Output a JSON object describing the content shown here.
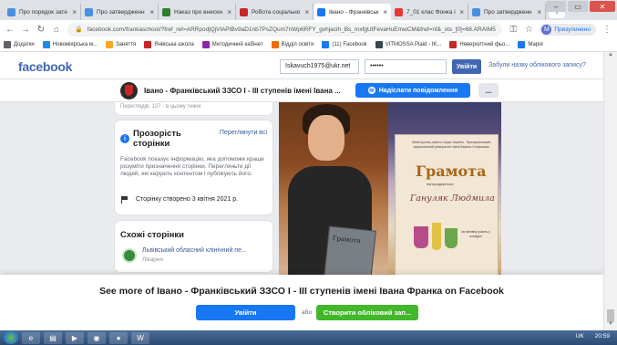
{
  "browser": {
    "tabs": [
      {
        "title": "Про порядок зате",
        "color": "#4a90e2",
        "active": false
      },
      {
        "title": "Про затвердженн",
        "color": "#4a90e2",
        "active": false
      },
      {
        "title": "Наказ про внесен",
        "color": "#2e7d32",
        "active": false
      },
      {
        "title": "Робота соціально",
        "color": "#c62828",
        "active": false
      },
      {
        "title": "Івано - Франківськ",
        "color": "#1877f2",
        "active": true
      },
      {
        "title": "7_01 клас Фонка і",
        "color": "#e53935",
        "active": false
      },
      {
        "title": "Про затвердженн",
        "color": "#4a90e2",
        "active": false
      }
    ],
    "url": "facebook.com/frankaschool/?fref_ref=ARRpodjQjVlAPtBv9aD1nb7PsZQum7nWp6RFY_gvhjacih_Bs_mxfgUtFevaHuEmwCM&fref=nf&_xts_[0]=68.ARAIM5",
    "profile_label": "Призупинено",
    "profile_initial": "M",
    "bookmarks": [
      {
        "label": "Додатки",
        "color": "#5f6368"
      },
      {
        "label": "Новоміярська м...",
        "color": "#1e88e5"
      },
      {
        "label": "Заняття",
        "color": "#f9a825"
      },
      {
        "label": "Янівська школа",
        "color": "#c62828"
      },
      {
        "label": "Методичний кабінет",
        "color": "#8e24aa"
      },
      {
        "label": "Відділ освіти",
        "color": "#ef6c00"
      },
      {
        "label": "(11) Facebook",
        "color": "#1877f2"
      },
      {
        "label": "VITMOSSA Plaid - IK...",
        "color": "#37474f"
      },
      {
        "label": "Неверолтний фьо...",
        "color": "#c62828"
      },
      {
        "label": "Марія",
        "color": "#1877f2"
      }
    ]
  },
  "fb": {
    "logo": "facebook",
    "email_value": "Iskavuch1975@ukr.net",
    "password_value": "••••••",
    "login_label": "Увійти",
    "forgot_label": "Забули назву облікового запису?"
  },
  "page": {
    "title": "Івано - Франківський ЗЗСО І - ІІІ ступенів імені Івана ...",
    "message_button": "Надіслати повідомлення",
    "more_button": "...",
    "stats_text": "Переглядів: 127 · в цьому тижні"
  },
  "transparency": {
    "title": "Прозорість сторінки",
    "link": "Переглянути всі",
    "description": "Facebook показує інформацію, яка допоможе краще розуміти призначення сторінки. Перегляньте дії людей, які керують контентом і публікують його.",
    "created": "Сторінку створено 3 квітня 2021 р."
  },
  "similar": {
    "title": "Схожі сторінки",
    "items": [
      {
        "name": "Львівський обласний клінічний пе...",
        "category": "Лікарня"
      }
    ]
  },
  "photos": {
    "book_text": "Грамота",
    "cert_header": "Міністерство освіти і науки України · Прикарпатський національний університет імені Василя Стефаника",
    "cert_title": "Грамота",
    "cert_sub": "нагороджується",
    "cert_name": "Гануляк Людмила",
    "cert_footer": "за активну участь у конкурсі"
  },
  "overlay": {
    "title": "See more of Івано - Франківський ЗЗСО І - ІІІ ступенів імені Івана Франка on Facebook",
    "login_label": "Увійти",
    "or_label": "або",
    "create_label": "Створити обліковий зап..."
  },
  "taskbar": {
    "lang": "UK",
    "time": "20:59"
  }
}
